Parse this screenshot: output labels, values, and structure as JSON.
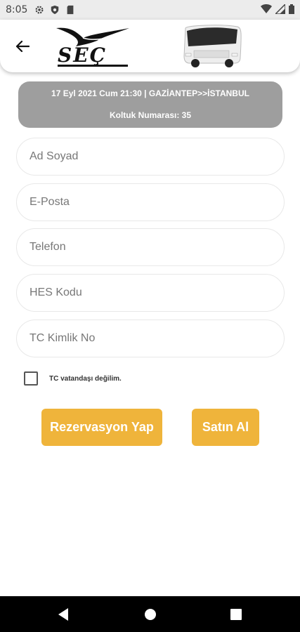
{
  "status_bar": {
    "time": "8:05"
  },
  "trip": {
    "summary": "17 Eyl 2021 Cum 21:30 | GAZİANTEP>>İSTANBUL",
    "seat": "Koltuk Numarası: 35"
  },
  "brand": {
    "logo_text": "SEÇ"
  },
  "form": {
    "name_placeholder": "Ad Soyad",
    "email_placeholder": "E-Posta",
    "phone_placeholder": "Telefon",
    "hes_placeholder": "HES Kodu",
    "tc_placeholder": "TC Kimlik No",
    "not_citizen_label": "TC vatandaşı değilim.",
    "not_citizen_checked": false
  },
  "buttons": {
    "reserve": "Rezervasyon Yap",
    "buy": "Satın Al"
  },
  "colors": {
    "accent": "#efb43b",
    "trip_card": "#9e9e9e"
  },
  "icons": {
    "back": "arrow-back-icon",
    "nav_back": "nav-back-icon",
    "nav_home": "nav-home-icon",
    "nav_recents": "nav-recents-icon"
  }
}
